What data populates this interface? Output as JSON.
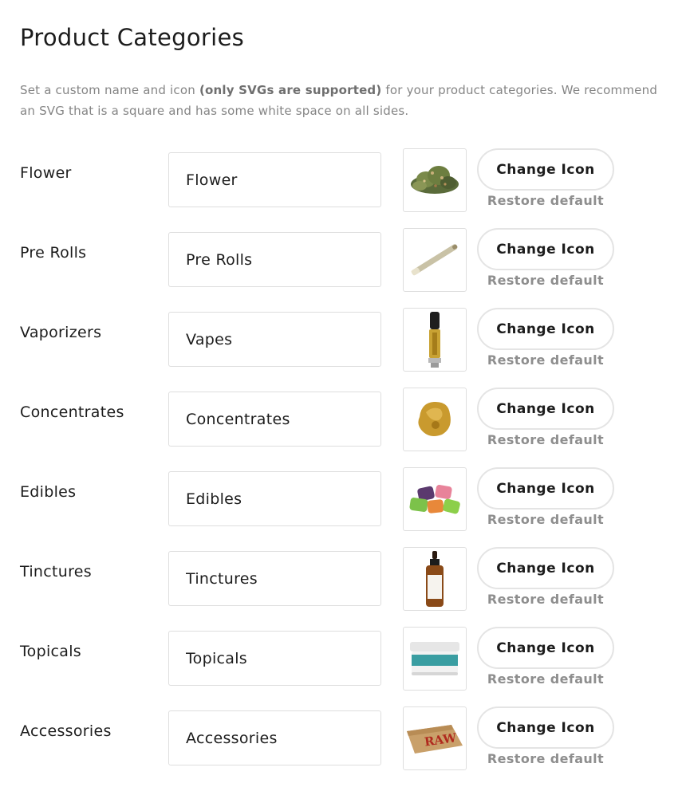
{
  "page": {
    "title": "Product Categories",
    "desc_prefix": "Set a custom name and icon ",
    "desc_bold": "(only SVGs are supported)",
    "desc_suffix": " for your product categories. We recommend an SVG that is a square and has some white space on all sides."
  },
  "categories": [
    {
      "label": "Flower",
      "value": "Flower",
      "icon": "flower-bud-icon",
      "change_label": "Change Icon",
      "restore_label": "Restore default"
    },
    {
      "label": "Pre Rolls",
      "value": "Pre Rolls",
      "icon": "pre-roll-icon",
      "change_label": "Change Icon",
      "restore_label": "Restore default"
    },
    {
      "label": "Vaporizers",
      "value": "Vapes",
      "icon": "vape-cartridge-icon",
      "change_label": "Change Icon",
      "restore_label": "Restore default"
    },
    {
      "label": "Concentrates",
      "value": "Concentrates",
      "icon": "concentrate-icon",
      "change_label": "Change Icon",
      "restore_label": "Restore default"
    },
    {
      "label": "Edibles",
      "value": "Edibles",
      "icon": "gummies-icon",
      "change_label": "Change Icon",
      "restore_label": "Restore default"
    },
    {
      "label": "Tinctures",
      "value": "Tinctures",
      "icon": "tincture-bottle-icon",
      "change_label": "Change Icon",
      "restore_label": "Restore default"
    },
    {
      "label": "Topicals",
      "value": "Topicals",
      "icon": "topical-jar-icon",
      "change_label": "Change Icon",
      "restore_label": "Restore default"
    },
    {
      "label": "Accessories",
      "value": "Accessories",
      "icon": "rolling-papers-icon",
      "change_label": "Change Icon",
      "restore_label": "Restore default",
      "icon_text": "RAW"
    }
  ]
}
